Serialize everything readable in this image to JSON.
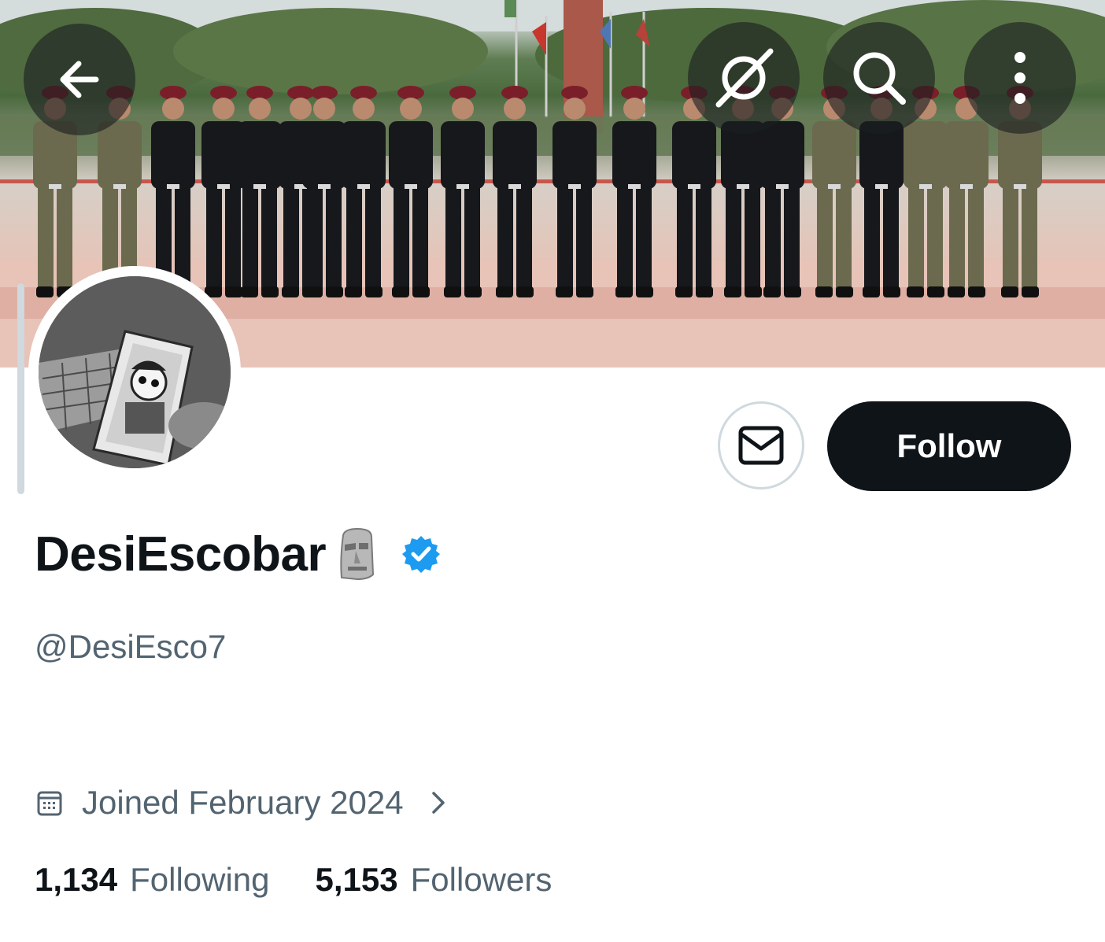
{
  "profile": {
    "display_name": "DesiEscobar",
    "handle": "@DesiEsco7",
    "joined": "Joined February 2024",
    "verified": true
  },
  "actions": {
    "follow_label": "Follow"
  },
  "stats": {
    "following_count": "1,134",
    "following_label": "Following",
    "followers_count": "5,153",
    "followers_label": "Followers"
  },
  "icons": {
    "back": "arrow-left-icon",
    "grok": "grok-icon",
    "search": "search-icon",
    "more": "more-vertical-icon",
    "message": "envelope-icon",
    "calendar": "calendar-icon",
    "chevron": "chevron-right-icon",
    "verified": "verified-badge-icon",
    "emoji": "moai-emoji-icon"
  },
  "colors": {
    "accent_dark": "#0f1419",
    "secondary_text": "#536471",
    "verified_blue": "#1d9bf0"
  }
}
